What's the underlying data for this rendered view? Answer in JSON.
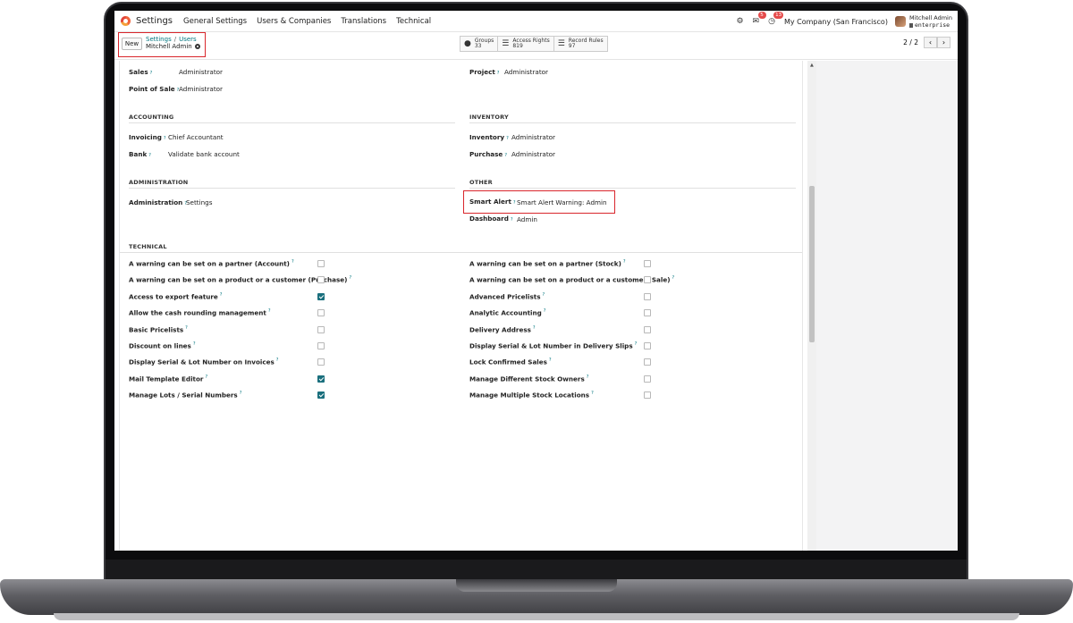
{
  "navbar": {
    "app_name": "Settings",
    "menu": [
      "General Settings",
      "Users & Companies",
      "Translations",
      "Technical"
    ],
    "chat_badge": "5",
    "activity_badge": "13",
    "company": "My Company (San Francisco)",
    "user_name": "Mitchell Admin",
    "database": "enterprise"
  },
  "control": {
    "new_label": "New",
    "breadcrumb_settings": "Settings",
    "breadcrumb_users": "Users",
    "record_name": "Mitchell Admin",
    "groups_label": "Groups",
    "groups_count": "33",
    "access_label": "Access Rights",
    "access_count": "819",
    "rules_label": "Record Rules",
    "rules_count": "97",
    "pager": "2 / 2"
  },
  "fields": {
    "sales_label": "Sales",
    "sales_value": "Administrator",
    "pos_label": "Point of Sale",
    "pos_value": "Administrator",
    "project_label": "Project",
    "project_value": "Administrator",
    "accounting_title": "ACCOUNTING",
    "inventory_title": "INVENTORY",
    "invoicing_label": "Invoicing",
    "invoicing_value": "Chief Accountant",
    "bank_label": "Bank",
    "bank_value": "Validate bank account",
    "inventory_label": "Inventory",
    "inventory_value": "Administrator",
    "purchase_label": "Purchase",
    "purchase_value": "Administrator",
    "administration_title": "ADMINISTRATION",
    "other_title": "OTHER",
    "admin_label": "Administration",
    "admin_value": "Settings",
    "smart_alert_label": "Smart Alert",
    "smart_alert_value": "Smart Alert Warning: Admin",
    "dashboard_label": "Dashboard",
    "dashboard_value": "Admin",
    "technical_title": "TECHNICAL"
  },
  "technical_left": [
    {
      "label": "A warning can be set on a partner (Account)",
      "checked": false
    },
    {
      "label": "A warning can be set on a product or a customer (Purchase)",
      "checked": false
    },
    {
      "label": "Access to export feature",
      "checked": true
    },
    {
      "label": "Allow the cash rounding management",
      "checked": false
    },
    {
      "label": "Basic Pricelists",
      "checked": false
    },
    {
      "label": "Discount on lines",
      "checked": false
    },
    {
      "label": "Display Serial & Lot Number on Invoices",
      "checked": false
    },
    {
      "label": "Mail Template Editor",
      "checked": true
    },
    {
      "label": "Manage Lots / Serial Numbers",
      "checked": true
    }
  ],
  "technical_right": [
    {
      "label": "A warning can be set on a partner (Stock)",
      "checked": false
    },
    {
      "label": "A warning can be set on a product or a customer (Sale)",
      "checked": false
    },
    {
      "label": "Advanced Pricelists",
      "checked": false
    },
    {
      "label": "Analytic Accounting",
      "checked": false
    },
    {
      "label": "Delivery Address",
      "checked": false
    },
    {
      "label": "Display Serial & Lot Number in Delivery Slips",
      "checked": false
    },
    {
      "label": "Lock Confirmed Sales",
      "checked": false
    },
    {
      "label": "Manage Different Stock Owners",
      "checked": false
    },
    {
      "label": "Manage Multiple Stock Locations",
      "checked": false
    }
  ],
  "colors": {
    "accent": "#01757f",
    "highlight": "#d9262c",
    "checkbox_on": "#1a6f7d"
  }
}
